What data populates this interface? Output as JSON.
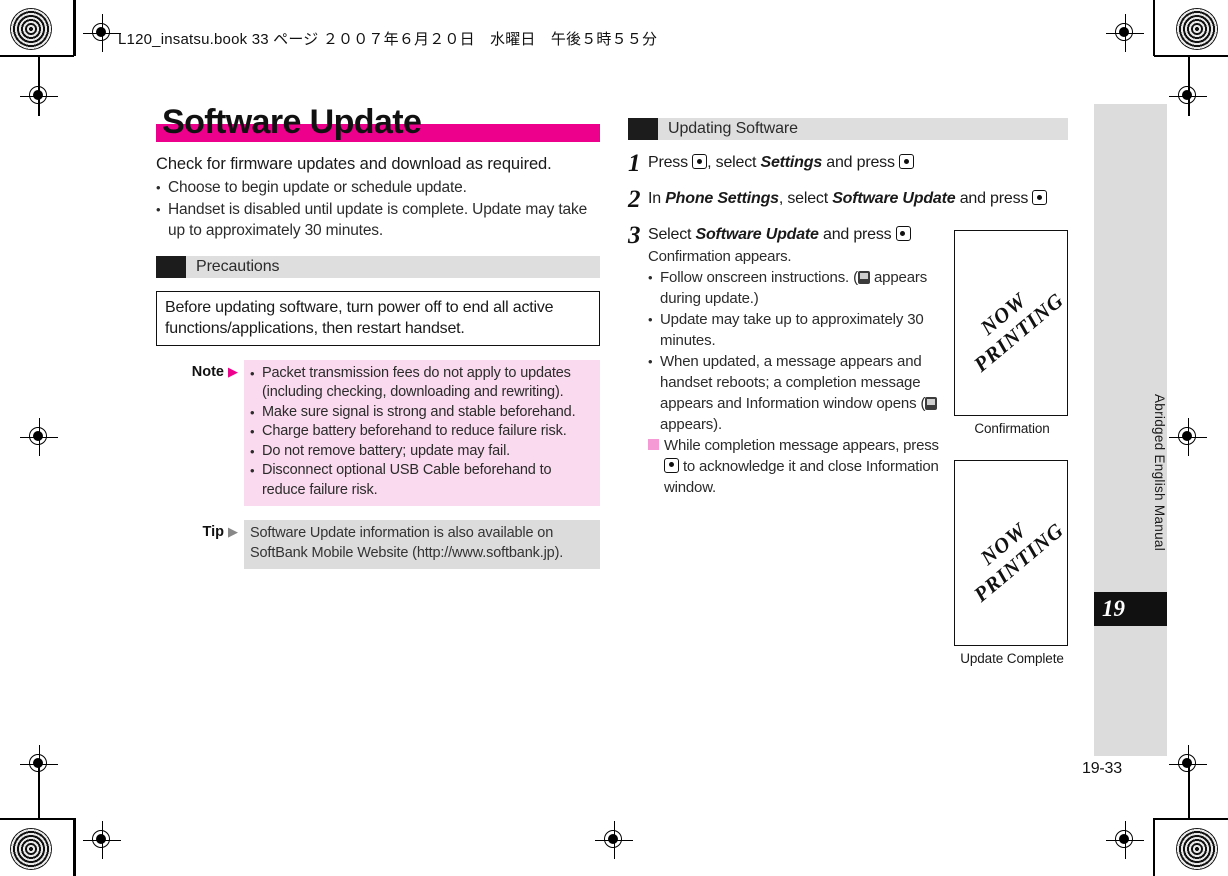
{
  "print_header": {
    "book_line": "L120_insatsu.book  33 ページ  ２００７年６月２０日　水曜日　午後５時５５分"
  },
  "colors": {
    "title_bar_magenta": "#ec008c",
    "note_pink": "#fadaee",
    "tip_gray": "#dcdcdc",
    "section_gray": "#dedede",
    "chip_black": "#1c1c1c",
    "pink_square": "#f59ad4"
  },
  "left_column": {
    "title": "Software Update",
    "lead": "Check for firmware updates and download as required.",
    "bullets": [
      "Choose to begin update or schedule update.",
      "Handset is disabled until update is complete. Update may take up to approximately 30 minutes."
    ],
    "precautions": {
      "section_label": "Precautions",
      "framed_text": "Before updating software, turn power off to end all active functions/applications, then restart handset.",
      "note": {
        "key": "Note",
        "arrow": "▶",
        "bullets": [
          "Packet transmission fees do not apply to updates (including checking, downloading and rewriting).",
          "Make sure signal is strong and stable beforehand.",
          "Charge battery beforehand to reduce failure risk.",
          "Do not remove battery; update may fail.",
          "Disconnect optional USB Cable beforehand to reduce failure risk."
        ]
      },
      "tip": {
        "key": "Tip",
        "arrow": "▶",
        "text": "Software Update information is also available on SoftBank Mobile Website (http://www.softbank.jp)."
      }
    }
  },
  "right_column": {
    "section_label": "Updating Software",
    "steps": [
      {
        "number": "1",
        "line_pre": "Press ",
        "line_mid": ", select ",
        "emphasis": "Settings",
        "line_post": " and press "
      },
      {
        "number": "2",
        "line_pre": "In ",
        "emphasis1": "Phone Settings",
        "line_mid": ", select ",
        "emphasis2": "Software Update",
        "line_post": " and press "
      },
      {
        "number": "3",
        "line_pre": "Select ",
        "emphasis": "Software Update",
        "line_post": " and press ",
        "result": "Confirmation appears.",
        "bullets": [
          {
            "pre": "Follow onscreen instructions. (",
            "icon": "update-device-icon",
            "post": " appears during update.)"
          },
          {
            "pre": "Update may take up to approximately 30 minutes.",
            "icon": "",
            "post": ""
          },
          {
            "pre": "When updated, a message appears and handset reboots; a completion message appears and Information window opens (",
            "icon": "information-window-icon",
            "post": " appears)."
          }
        ],
        "sub_note_pre": "While completion message appears, press ",
        "sub_note_post": " to acknowledge it and close Information window."
      }
    ]
  },
  "figures": [
    {
      "placeholder_text": "NOW\nPRINTING",
      "caption": "Confirmation"
    },
    {
      "placeholder_text": "NOW\nPRINTING",
      "caption": "Update Complete"
    }
  ],
  "tab_strip": {
    "vertical_label": "Abridged English Manual",
    "chapter_number": "19"
  },
  "page_number": "19-33"
}
